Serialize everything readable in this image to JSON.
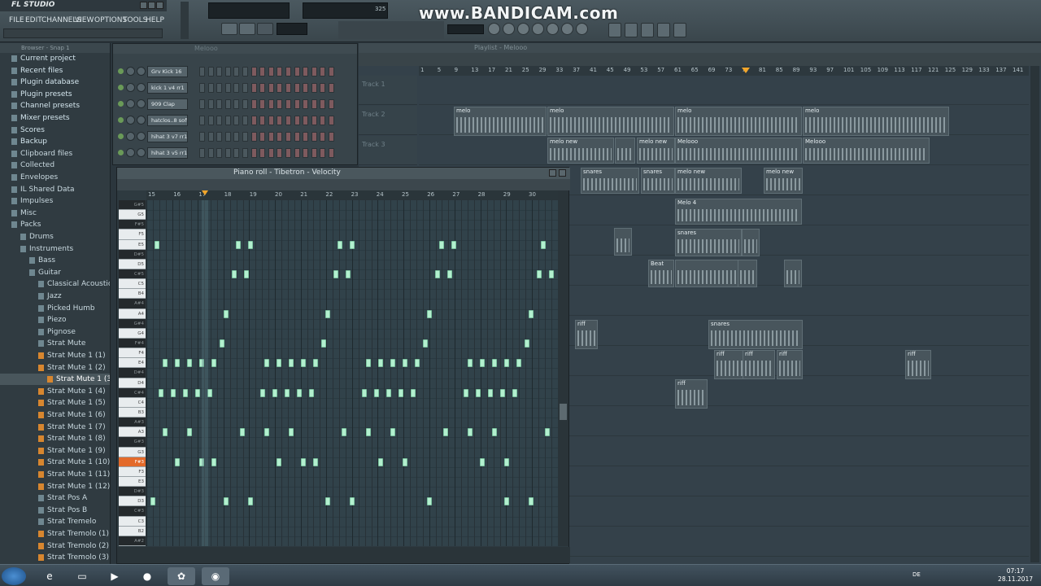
{
  "app": {
    "title": "FL STUDIO",
    "menu": [
      "FILE",
      "EDIT",
      "CHANNELS",
      "VIEW",
      "OPTIONS",
      "TOOLS",
      "HELP"
    ],
    "watermark": "www.BANDICAM.com",
    "tempo": "325"
  },
  "browser": {
    "header": "Browser - Snap 1",
    "items": [
      {
        "label": "Current project",
        "level": 0,
        "type": "top"
      },
      {
        "label": "Recent files",
        "level": 0,
        "type": "top"
      },
      {
        "label": "Plugin database",
        "level": 0,
        "type": "top"
      },
      {
        "label": "Plugin presets",
        "level": 0,
        "type": "top"
      },
      {
        "label": "Channel presets",
        "level": 0,
        "type": "top"
      },
      {
        "label": "Mixer presets",
        "level": 0,
        "type": "top"
      },
      {
        "label": "Scores",
        "level": 0,
        "type": "top"
      },
      {
        "label": "Backup",
        "level": 0,
        "type": "top"
      },
      {
        "label": "Clipboard files",
        "level": 0,
        "type": "folder"
      },
      {
        "label": "Collected",
        "level": 0,
        "type": "folder"
      },
      {
        "label": "Envelopes",
        "level": 0,
        "type": "folder"
      },
      {
        "label": "IL Shared Data",
        "level": 0,
        "type": "folder"
      },
      {
        "label": "Impulses",
        "level": 0,
        "type": "folder"
      },
      {
        "label": "Misc",
        "level": 0,
        "type": "folder"
      },
      {
        "label": "Packs",
        "level": 0,
        "type": "folder"
      },
      {
        "label": "Drums",
        "level": 1,
        "type": "folder"
      },
      {
        "label": "Instruments",
        "level": 1,
        "type": "folder"
      },
      {
        "label": "Bass",
        "level": 2,
        "type": "folder"
      },
      {
        "label": "Guitar",
        "level": 2,
        "type": "folder"
      },
      {
        "label": "Classical Acoustic",
        "level": 3,
        "type": "folder"
      },
      {
        "label": "Jazz",
        "level": 3,
        "type": "folder"
      },
      {
        "label": "Picked Humb",
        "level": 3,
        "type": "folder"
      },
      {
        "label": "Piezo",
        "level": 3,
        "type": "folder"
      },
      {
        "label": "Pignose",
        "level": 3,
        "type": "folder"
      },
      {
        "label": "Strat Mute",
        "level": 3,
        "type": "folder"
      },
      {
        "label": "Strat Mute 1 (1)",
        "level": 3,
        "type": "file"
      },
      {
        "label": "Strat Mute 1 (2)",
        "level": 3,
        "type": "file"
      },
      {
        "label": "Strat Mute 1 (3)",
        "level": 4,
        "type": "file",
        "selected": true
      },
      {
        "label": "Strat Mute 1 (4)",
        "level": 3,
        "type": "file"
      },
      {
        "label": "Strat Mute 1 (5)",
        "level": 3,
        "type": "file"
      },
      {
        "label": "Strat Mute 1 (6)",
        "level": 3,
        "type": "file"
      },
      {
        "label": "Strat Mute 1 (7)",
        "level": 3,
        "type": "file"
      },
      {
        "label": "Strat Mute 1 (8)",
        "level": 3,
        "type": "file"
      },
      {
        "label": "Strat Mute 1 (9)",
        "level": 3,
        "type": "file"
      },
      {
        "label": "Strat Mute 1 (10)",
        "level": 3,
        "type": "file"
      },
      {
        "label": "Strat Mute 1 (11)",
        "level": 3,
        "type": "file"
      },
      {
        "label": "Strat Mute 1 (12)",
        "level": 3,
        "type": "file"
      },
      {
        "label": "Strat Pos A",
        "level": 3,
        "type": "folder"
      },
      {
        "label": "Strat Pos B",
        "level": 3,
        "type": "folder"
      },
      {
        "label": "Strat Tremelo",
        "level": 3,
        "type": "folder"
      },
      {
        "label": "Strat Tremolo (1)",
        "level": 3,
        "type": "file"
      },
      {
        "label": "Strat Tremolo (2)",
        "level": 3,
        "type": "file"
      },
      {
        "label": "Strat Tremolo (3)",
        "level": 3,
        "type": "file"
      }
    ]
  },
  "channel_rack": {
    "title": "Melooo",
    "channels": [
      {
        "name": "Grv Kick 16",
        "steps": [
          0,
          0,
          0,
          0,
          0,
          0,
          1,
          1,
          1,
          1,
          1,
          1,
          1,
          1,
          1,
          1
        ]
      },
      {
        "name": "kick 1 v4 rr1",
        "steps": [
          0,
          0,
          0,
          0,
          0,
          0,
          1,
          1,
          1,
          1,
          1,
          1,
          1,
          1,
          1,
          1
        ]
      },
      {
        "name": "909 Clap",
        "steps": [
          0,
          0,
          0,
          0,
          0,
          0,
          1,
          1,
          1,
          1,
          1,
          1,
          1,
          1,
          1,
          1
        ]
      },
      {
        "name": "hatclos..8 soft",
        "steps": [
          0,
          0,
          0,
          0,
          0,
          0,
          1,
          1,
          1,
          1,
          1,
          1,
          1,
          1,
          1,
          1
        ]
      },
      {
        "name": "hihat 3 v7 rr1",
        "steps": [
          0,
          0,
          0,
          0,
          0,
          0,
          1,
          1,
          1,
          1,
          1,
          1,
          1,
          1,
          1,
          1
        ]
      },
      {
        "name": "hihat 3 v5 rr1",
        "steps": [
          0,
          0,
          0,
          0,
          0,
          0,
          1,
          1,
          1,
          1,
          1,
          1,
          1,
          1,
          1,
          1
        ]
      }
    ]
  },
  "playlist": {
    "title": "Playlist - Melooo",
    "ruler": [
      "1",
      "5",
      "9",
      "13",
      "17",
      "21",
      "25",
      "29",
      "33",
      "37",
      "41",
      "45",
      "49",
      "53",
      "57",
      "61",
      "65",
      "69",
      "73",
      "77",
      "81",
      "85",
      "89",
      "93",
      "97",
      "101",
      "105",
      "109",
      "113",
      "117",
      "121",
      "125",
      "129",
      "133",
      "137",
      "141"
    ],
    "tracks": [
      "Track 1",
      "Track 2",
      "Track 3"
    ],
    "clip_labels": [
      "melo",
      "melo",
      "melo",
      "melo",
      "melo new",
      "melo new",
      "Melooo",
      "Melooo",
      "snares",
      "snares",
      "melo new",
      "melo new",
      "Melo 4",
      "snares",
      "Beat",
      "riff",
      "snares",
      "riff",
      "riff",
      "riff",
      "riff",
      "riff"
    ]
  },
  "piano_roll": {
    "title": "Piano roll - Tibetron - Velocity",
    "ruler": [
      "15",
      "16",
      "17",
      "18",
      "19",
      "20",
      "21",
      "22",
      "23",
      "24",
      "25",
      "26",
      "27",
      "28",
      "29",
      "30"
    ],
    "keys": [
      "G#5",
      "G5",
      "F#5",
      "F5",
      "E5",
      "D#5",
      "D5",
      "C#5",
      "C5",
      "B4",
      "A#4",
      "A4",
      "G#4",
      "G4",
      "F#4",
      "F4",
      "E4",
      "D#4",
      "D4",
      "C#4",
      "C4",
      "B3",
      "A#3",
      "A3",
      "G#3",
      "G3",
      "F#3",
      "F3",
      "E3",
      "D#3",
      "D3",
      "C#3",
      "C3",
      "B2",
      "A#2"
    ],
    "active_key": "F#3",
    "notes": [
      {
        "key": "E5",
        "t": 0.02
      },
      {
        "key": "E5",
        "t": 0.22
      },
      {
        "key": "E5",
        "t": 0.25
      },
      {
        "key": "E5",
        "t": 0.47
      },
      {
        "key": "E5",
        "t": 0.5
      },
      {
        "key": "E5",
        "t": 0.72
      },
      {
        "key": "E5",
        "t": 0.75
      },
      {
        "key": "E5",
        "t": 0.97
      },
      {
        "key": "C#5",
        "t": 0.21
      },
      {
        "key": "C#5",
        "t": 0.24
      },
      {
        "key": "C#5",
        "t": 0.46
      },
      {
        "key": "C#5",
        "t": 0.49
      },
      {
        "key": "C#5",
        "t": 0.71
      },
      {
        "key": "C#5",
        "t": 0.74
      },
      {
        "key": "C#5",
        "t": 0.96
      },
      {
        "key": "C#5",
        "t": 0.99
      },
      {
        "key": "A4",
        "t": 0.19
      },
      {
        "key": "A4",
        "t": 0.44
      },
      {
        "key": "A4",
        "t": 0.69
      },
      {
        "key": "A4",
        "t": 0.94
      },
      {
        "key": "F#4",
        "t": 0.18
      },
      {
        "key": "F#4",
        "t": 0.43
      },
      {
        "key": "F#4",
        "t": 0.68
      },
      {
        "key": "F#4",
        "t": 0.93
      },
      {
        "key": "E4",
        "t": 0.04
      },
      {
        "key": "E4",
        "t": 0.07
      },
      {
        "key": "E4",
        "t": 0.1
      },
      {
        "key": "E4",
        "t": 0.13
      },
      {
        "key": "E4",
        "t": 0.16
      },
      {
        "key": "E4",
        "t": 0.29
      },
      {
        "key": "E4",
        "t": 0.32
      },
      {
        "key": "E4",
        "t": 0.35
      },
      {
        "key": "E4",
        "t": 0.38
      },
      {
        "key": "E4",
        "t": 0.41
      },
      {
        "key": "E4",
        "t": 0.54
      },
      {
        "key": "E4",
        "t": 0.57
      },
      {
        "key": "E4",
        "t": 0.6
      },
      {
        "key": "E4",
        "t": 0.63
      },
      {
        "key": "E4",
        "t": 0.66
      },
      {
        "key": "E4",
        "t": 0.79
      },
      {
        "key": "E4",
        "t": 0.82
      },
      {
        "key": "E4",
        "t": 0.85
      },
      {
        "key": "E4",
        "t": 0.88
      },
      {
        "key": "E4",
        "t": 0.91
      },
      {
        "key": "C#4",
        "t": 0.03
      },
      {
        "key": "C#4",
        "t": 0.06
      },
      {
        "key": "C#4",
        "t": 0.09
      },
      {
        "key": "C#4",
        "t": 0.12
      },
      {
        "key": "C#4",
        "t": 0.15
      },
      {
        "key": "C#4",
        "t": 0.28
      },
      {
        "key": "C#4",
        "t": 0.31
      },
      {
        "key": "C#4",
        "t": 0.34
      },
      {
        "key": "C#4",
        "t": 0.37
      },
      {
        "key": "C#4",
        "t": 0.4
      },
      {
        "key": "C#4",
        "t": 0.53
      },
      {
        "key": "C#4",
        "t": 0.56
      },
      {
        "key": "C#4",
        "t": 0.59
      },
      {
        "key": "C#4",
        "t": 0.62
      },
      {
        "key": "C#4",
        "t": 0.65
      },
      {
        "key": "C#4",
        "t": 0.78
      },
      {
        "key": "C#4",
        "t": 0.81
      },
      {
        "key": "C#4",
        "t": 0.84
      },
      {
        "key": "C#4",
        "t": 0.87
      },
      {
        "key": "C#4",
        "t": 0.9
      },
      {
        "key": "A3",
        "t": 0.04
      },
      {
        "key": "A3",
        "t": 0.1
      },
      {
        "key": "A3",
        "t": 0.23
      },
      {
        "key": "A3",
        "t": 0.29
      },
      {
        "key": "A3",
        "t": 0.35
      },
      {
        "key": "A3",
        "t": 0.48
      },
      {
        "key": "A3",
        "t": 0.54
      },
      {
        "key": "A3",
        "t": 0.6
      },
      {
        "key": "A3",
        "t": 0.73
      },
      {
        "key": "A3",
        "t": 0.79
      },
      {
        "key": "A3",
        "t": 0.85
      },
      {
        "key": "A3",
        "t": 0.98
      },
      {
        "key": "F#3",
        "t": 0.07
      },
      {
        "key": "F#3",
        "t": 0.13
      },
      {
        "key": "F#3",
        "t": 0.16
      },
      {
        "key": "F#3",
        "t": 0.32
      },
      {
        "key": "F#3",
        "t": 0.38
      },
      {
        "key": "F#3",
        "t": 0.41
      },
      {
        "key": "F#3",
        "t": 0.57
      },
      {
        "key": "F#3",
        "t": 0.63
      },
      {
        "key": "F#3",
        "t": 0.82
      },
      {
        "key": "F#3",
        "t": 0.88
      },
      {
        "key": "D3",
        "t": 0.01
      },
      {
        "key": "D3",
        "t": 0.19
      },
      {
        "key": "D3",
        "t": 0.25
      },
      {
        "key": "D3",
        "t": 0.44
      },
      {
        "key": "D3",
        "t": 0.5
      },
      {
        "key": "D3",
        "t": 0.69
      },
      {
        "key": "D3",
        "t": 0.88
      },
      {
        "key": "D3",
        "t": 0.94
      }
    ]
  },
  "taskbar": {
    "lang": "DE",
    "time": "07:17",
    "date": "28.11.2017"
  }
}
